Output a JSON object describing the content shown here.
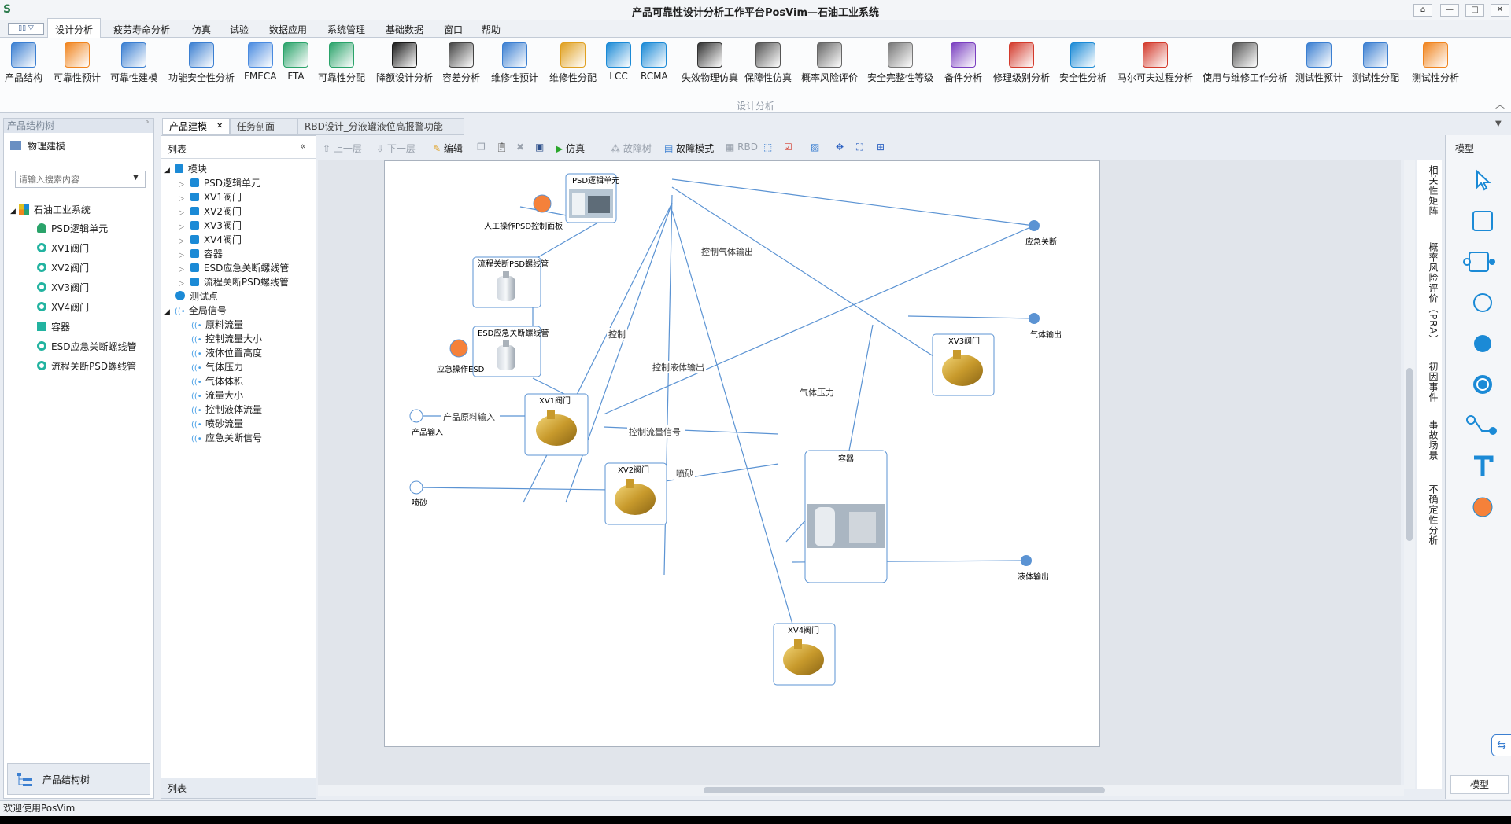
{
  "app": {
    "title": "产品可靠性设计分析工作平台PosVim—石油工业系统",
    "logo": "S"
  },
  "window_buttons": [
    "⌂",
    "—",
    "□",
    "✕"
  ],
  "menu": {
    "toggle_label": "▯▯ ▽",
    "items": [
      "设计分析",
      "疲劳寿命分析",
      "仿真",
      "试验",
      "数据应用",
      "系统管理",
      "基础数据",
      "窗口",
      "帮助"
    ]
  },
  "ribbon": {
    "group_label": "设计分析",
    "buttons": [
      {
        "label": "产品结构",
        "icon": "product-structure-icon",
        "color": "#3b7fd1"
      },
      {
        "label": "可靠性预计",
        "icon": "lambda-icon",
        "color": "#f0841e"
      },
      {
        "label": "可靠性建模",
        "icon": "reliability-model-icon",
        "color": "#3b7fd1"
      },
      {
        "label": "功能安全性分析",
        "icon": "functional-safety-icon",
        "color": "#3b7fd1"
      },
      {
        "label": "FMECA",
        "icon": "fmeca-icon",
        "color": "#4a8be0"
      },
      {
        "label": "FTA",
        "icon": "fta-icon",
        "color": "#2aa36a"
      },
      {
        "label": "可靠性分配",
        "icon": "reliability-allocation-icon",
        "color": "#2aa36a"
      },
      {
        "label": "降额设计分析",
        "icon": "derating-icon",
        "color": "#1a1a1a"
      },
      {
        "label": "容差分析",
        "icon": "tolerance-icon",
        "color": "#444444"
      },
      {
        "label": "维修性预计",
        "icon": "maintainability-predict-icon",
        "color": "#3b7fd1"
      },
      {
        "label": "维修性分配",
        "icon": "maintainability-allocation-icon",
        "color": "#e0a020"
      },
      {
        "label": "LCC",
        "icon": "lcc-icon",
        "color": "#1b8ad6"
      },
      {
        "label": "RCMA",
        "icon": "rcma-icon",
        "color": "#1b8ad6"
      },
      {
        "label": "失效物理仿真",
        "icon": "pof-icon",
        "color": "#333333"
      },
      {
        "label": "保障性仿真",
        "icon": "support-sim-icon",
        "color": "#555555"
      },
      {
        "label": "概率风险评价",
        "icon": "pra-icon",
        "color": "#666666"
      },
      {
        "label": "安全完整性等级",
        "icon": "sil-icon",
        "color": "#777777"
      },
      {
        "label": "备件分析",
        "icon": "spare-parts-icon",
        "color": "#7a3fc0"
      },
      {
        "label": "修理级别分析",
        "icon": "repair-level-icon",
        "color": "#d33a2c"
      },
      {
        "label": "安全性分析",
        "icon": "shield-icon",
        "color": "#1b8ad6"
      },
      {
        "label": "马尔可夫过程分析",
        "icon": "markov-icon",
        "color": "#d33a2c"
      },
      {
        "label": "使用与维修工作分析",
        "icon": "tools-icon",
        "color": "#555555"
      },
      {
        "label": "测试性预计",
        "icon": "testability-predict-icon",
        "color": "#3b7fd1"
      },
      {
        "label": "测试性分配",
        "icon": "testability-allocation-icon",
        "color": "#3b7fd1"
      },
      {
        "label": "测试性分析",
        "icon": "testability-analysis-icon",
        "color": "#f0841e"
      }
    ]
  },
  "left_panel": {
    "title": "产品结构树",
    "pin": "ᵖ",
    "physical_modeling": "物理建模",
    "search_placeholder": "请输入搜索内容",
    "root": "石油工业系统",
    "items": [
      "PSD逻辑单元",
      "XV1阀门",
      "XV2阀门",
      "XV3阀门",
      "XV4阀门",
      "容器",
      "ESD应急关断螺线管",
      "流程关断PSD螺线管"
    ],
    "bottom_button": "产品结构树"
  },
  "doc_tabs": [
    {
      "label": "产品建模",
      "close": "✕",
      "active": true
    },
    {
      "label": "任务剖面",
      "active": false
    },
    {
      "label": "RBD设计_分液罐液位高报警功能",
      "active": false
    }
  ],
  "list_panel": {
    "title": "列表",
    "collapse": "«",
    "modules_label": "模块",
    "modules": [
      "PSD逻辑单元",
      "XV1阀门",
      "XV2阀门",
      "XV3阀门",
      "XV4阀门",
      "容器",
      "ESD应急关断螺线管",
      "流程关断PSD螺线管"
    ],
    "test_points": "测试点",
    "global_signals_label": "全局信号",
    "signals": [
      "原料流量",
      "控制流量大小",
      "液体位置高度",
      "气体压力",
      "气体体积",
      "流量大小",
      "控制液体流量",
      "喷砂流量",
      "应急关断信号"
    ],
    "footer": "列表"
  },
  "toolbar": {
    "up": "上一层",
    "down": "下一层",
    "edit": "编辑",
    "simulate": "仿真",
    "fault_tree": "故障树",
    "fault_mode": "故障模式",
    "rbd": "RBD"
  },
  "diagram": {
    "components": {
      "psd": "PSD逻辑单元",
      "flow_solenoid": "流程关断PSD螺线管",
      "esd_solenoid": "ESD应急关断螺线管",
      "xv1": "XV1阀门",
      "xv2": "XV2阀门",
      "xv3": "XV3阀门",
      "xv4": "XV4阀门",
      "vessel": "容器"
    },
    "ports": {
      "manual_panel": "人工操作PSD控制面板",
      "emergency_esd": "应急操作ESD",
      "product_input": "产品输入",
      "sand": "喷砂",
      "emergency_shutdown": "应急关断",
      "gas_output": "气体输出",
      "liquid_output": "液体输出"
    },
    "edges": {
      "control_gas": "控制气体输出",
      "control": "控制",
      "control_liquid": "控制液体输出",
      "gas_pressure": "气体压力",
      "raw_input": "产品原料输入",
      "flow_signal": "控制流量信号",
      "sand": "喷砂"
    },
    "colors": {
      "line": "#5b93d3",
      "accent": "#f5813a",
      "port": "#5b93d3"
    }
  },
  "side_tabs": [
    "相关性矩阵",
    "概率风险评价（PRA）",
    "初因事件",
    "事故场景",
    "不确定性分析"
  ],
  "model_panel": {
    "title": "模型",
    "footer": "模型"
  },
  "status": "欢迎使用PosVim"
}
